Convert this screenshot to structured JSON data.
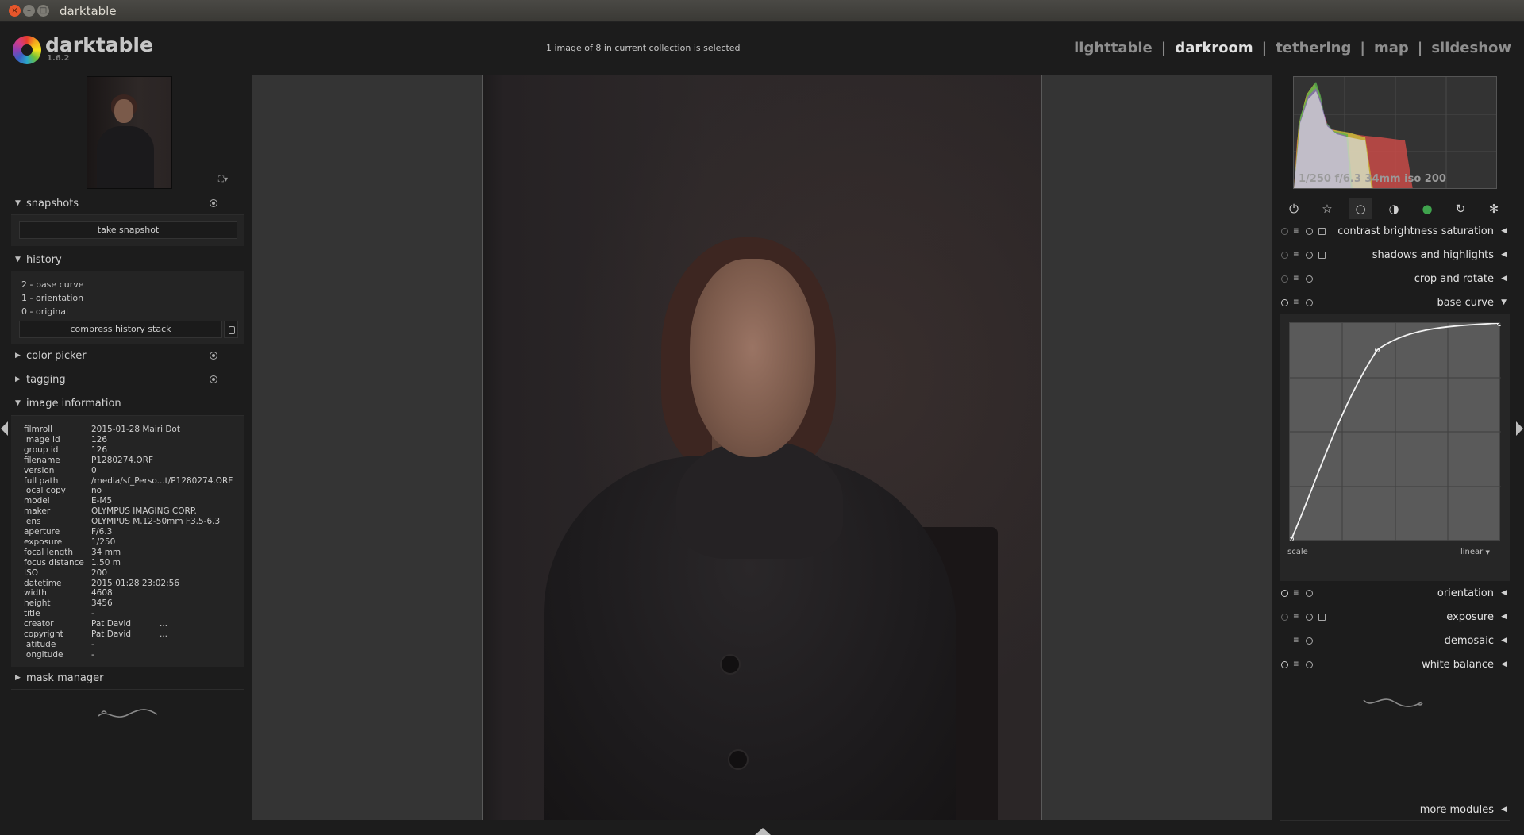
{
  "window": {
    "title": "darktable",
    "close": "×",
    "minimize": "–",
    "maximize": "□"
  },
  "app": {
    "name": "darktable",
    "version": "1.6.2"
  },
  "header": {
    "selection_info": "1 image of 8 in current collection is selected"
  },
  "views": [
    {
      "label": "lighttable"
    },
    {
      "label": "darkroom",
      "active": true
    },
    {
      "label": "tethering"
    },
    {
      "label": "map"
    },
    {
      "label": "slideshow"
    }
  ],
  "view_separator": "|",
  "left": {
    "snapshots": {
      "title": "snapshots",
      "take_snapshot": "take snapshot"
    },
    "history": {
      "title": "history",
      "items": [
        "2 - base curve",
        "1 - orientation",
        "0 - original"
      ],
      "compress": "compress history stack"
    },
    "color_picker": {
      "title": "color picker"
    },
    "tagging": {
      "title": "tagging"
    },
    "image_information": {
      "title": "image information",
      "rows": [
        {
          "k": "filmroll",
          "v": "2015-01-28 Mairi Dot",
          "e": ""
        },
        {
          "k": "image id",
          "v": "126",
          "e": ""
        },
        {
          "k": "group id",
          "v": "126",
          "e": ""
        },
        {
          "k": "filename",
          "v": "P1280274.ORF",
          "e": ""
        },
        {
          "k": "version",
          "v": "0",
          "e": ""
        },
        {
          "k": "full path",
          "v": "/media/sf_Perso...t/P1280274.ORF",
          "e": ""
        },
        {
          "k": "local copy",
          "v": "no",
          "e": ""
        },
        {
          "k": "model",
          "v": "E-M5",
          "e": ""
        },
        {
          "k": "maker",
          "v": "OLYMPUS IMAGING CORP.",
          "e": ""
        },
        {
          "k": "lens",
          "v": "OLYMPUS M.12-50mm F3.5-6.3",
          "e": ""
        },
        {
          "k": "aperture",
          "v": "F/6.3",
          "e": ""
        },
        {
          "k": "exposure",
          "v": "1/250",
          "e": ""
        },
        {
          "k": "focal length",
          "v": "34 mm",
          "e": ""
        },
        {
          "k": "focus distance",
          "v": "1.50 m",
          "e": ""
        },
        {
          "k": "ISO",
          "v": "200",
          "e": ""
        },
        {
          "k": "datetime",
          "v": "2015:01:28 23:02:56",
          "e": ""
        },
        {
          "k": "width",
          "v": "4608",
          "e": ""
        },
        {
          "k": "height",
          "v": "3456",
          "e": ""
        },
        {
          "k": "title",
          "v": "-",
          "e": ""
        },
        {
          "k": "creator",
          "v": "Pat David",
          "e": "..."
        },
        {
          "k": "copyright",
          "v": "Pat David",
          "e": "..."
        },
        {
          "k": "latitude",
          "v": "-",
          "e": ""
        },
        {
          "k": "longitude",
          "v": "-",
          "e": ""
        }
      ]
    },
    "mask_manager": {
      "title": "mask manager"
    }
  },
  "icons": {
    "expanded": "▼",
    "collapsed": "▶",
    "module_collapsed": "◀",
    "module_expanded": "▼",
    "zoom_fit": "⛶▾",
    "presets_menu": "≡"
  },
  "right": {
    "histogram_exif": "1/250 f/6.3 34mm iso 200",
    "module_groups": [
      {
        "name": "active-modules",
        "glyph": "⏻"
      },
      {
        "name": "favorites",
        "glyph": "☆"
      },
      {
        "name": "basic",
        "glyph": "○"
      },
      {
        "name": "tone",
        "glyph": "◑"
      },
      {
        "name": "color",
        "glyph": "●"
      },
      {
        "name": "correct",
        "glyph": "↻"
      },
      {
        "name": "effect",
        "glyph": "✻"
      }
    ],
    "modules": [
      {
        "name": "contrast brightness saturation",
        "power": false,
        "mask": true
      },
      {
        "name": "shadows and highlights",
        "power": false,
        "mask": true
      },
      {
        "name": "crop and rotate",
        "power": false,
        "mask": false
      },
      {
        "name": "base curve",
        "power": true,
        "mask": false,
        "expanded": true
      },
      {
        "name": "orientation",
        "power": true,
        "mask": false
      },
      {
        "name": "exposure",
        "power": false,
        "mask": true
      },
      {
        "name": "demosaic",
        "power": null,
        "mask": false
      },
      {
        "name": "white balance",
        "power": true,
        "mask": false
      }
    ],
    "base_curve": {
      "scale_label": "scale",
      "mode": "linear",
      "mode_arrow": "▼"
    },
    "more_modules": "more modules"
  },
  "colors": {
    "accent": "#e0e0e0",
    "panel": "#1c1c1c",
    "center": "#343434"
  }
}
